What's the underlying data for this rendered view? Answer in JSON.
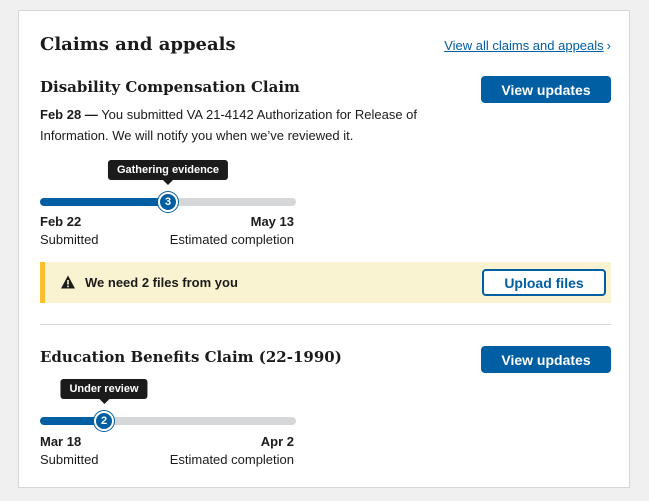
{
  "section": {
    "title": "Claims and appeals",
    "view_all_link": "View all claims and appeals",
    "link_chevron": "›"
  },
  "claims": [
    {
      "title": "Disability Compensation Claim",
      "button_label": "View updates",
      "update_date": "Feb 28",
      "update_dash": "—",
      "update_text": "You submitted VA 21-4142 Authorization for Release of Information. We will notify you when we’ve reviewed it.",
      "progress": {
        "status": "Gathering evidence",
        "step": "3",
        "fraction": 0.5,
        "start_date": "Feb 22",
        "start_label": "Submitted",
        "end_date": "May 13",
        "end_label": "Estimated completion"
      },
      "alert": {
        "icon": "warning-icon",
        "text": "We need 2 files from you",
        "button_label": "Upload files"
      }
    },
    {
      "title": "Education Benefits Claim (22-1990)",
      "button_label": "View updates",
      "progress": {
        "status": "Under review",
        "step": "2",
        "fraction": 0.25,
        "start_date": "Mar 18",
        "start_label": "Submitted",
        "end_date": "Apr 2",
        "end_label": "Estimated completion"
      }
    }
  ],
  "colors": {
    "primary": "#005ea2",
    "alert_bg": "#faf3d1",
    "alert_border": "#ffbe2e",
    "tooltip_bg": "#1b1b1b",
    "track": "#d6d7d9"
  }
}
